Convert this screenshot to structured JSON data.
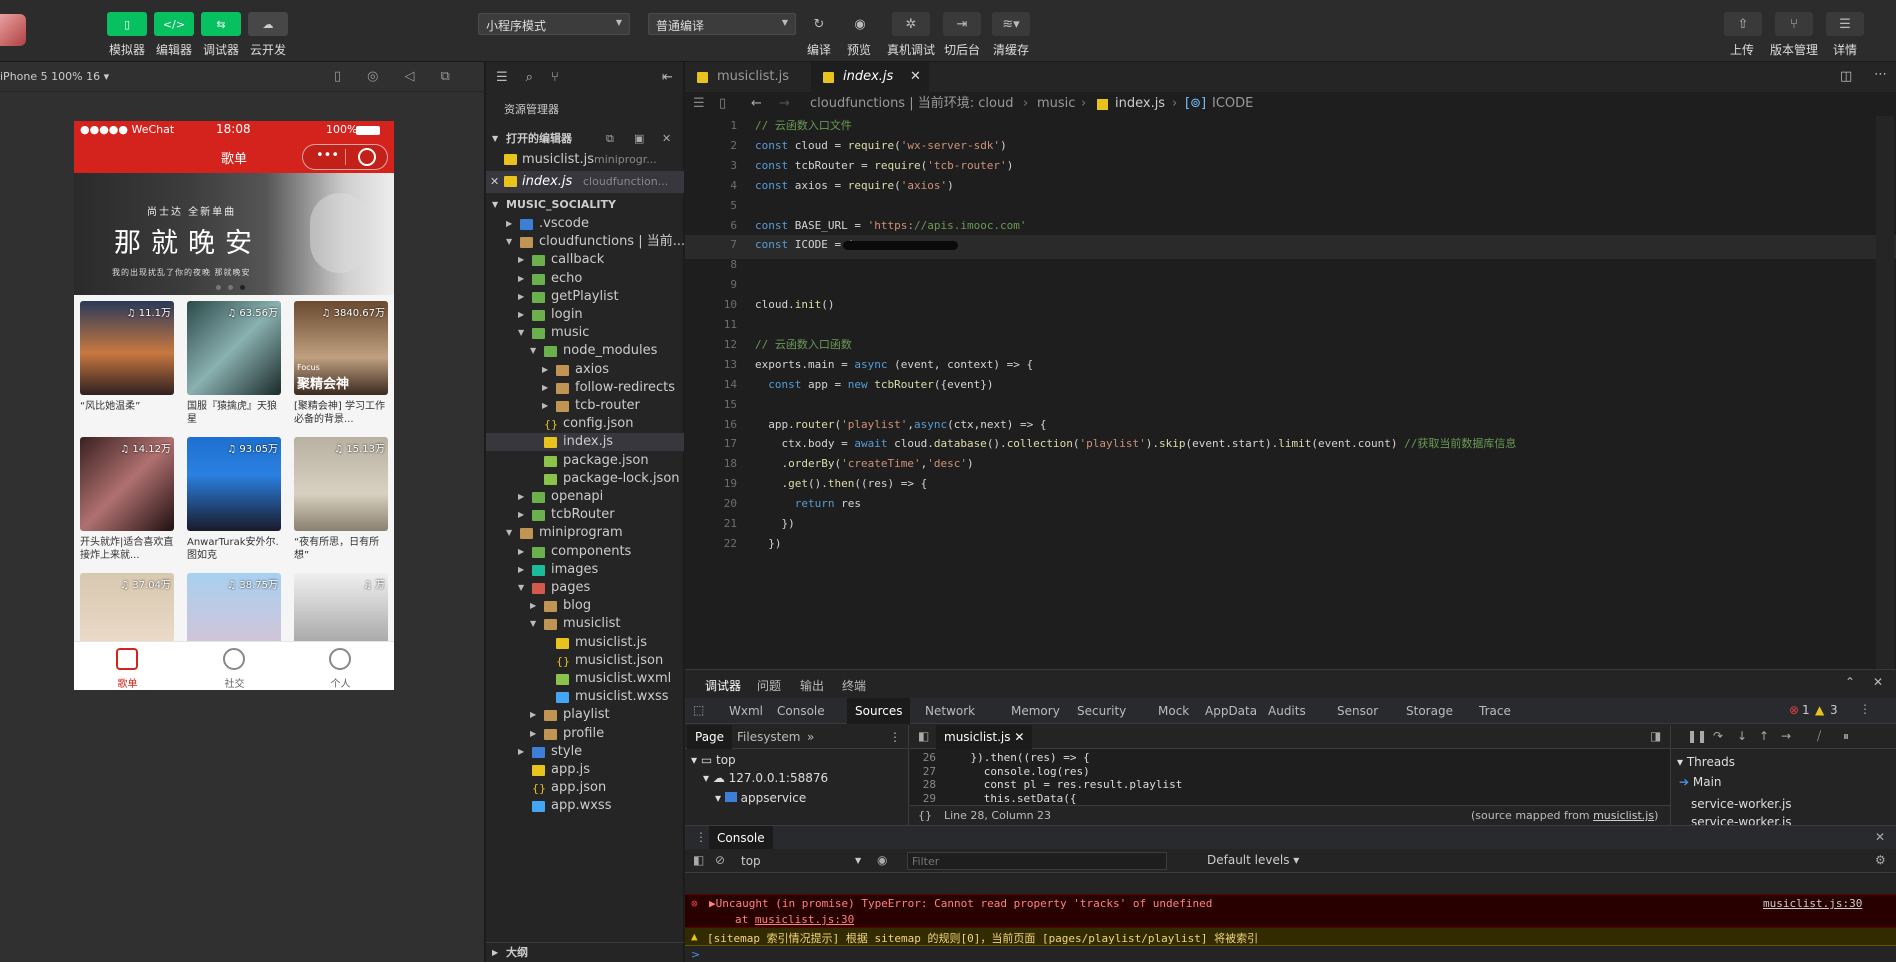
{
  "toolbar": {
    "left_buttons": [
      {
        "label": "模拟器",
        "icon": "phone-icon"
      },
      {
        "label": "编辑器",
        "icon": "code-icon"
      },
      {
        "label": "调试器",
        "icon": "debug-icon"
      },
      {
        "label": "云开发",
        "icon": "cloud-icon"
      }
    ],
    "mode_select": "小程序模式",
    "compile_select": "普通编译",
    "mid_buttons": [
      {
        "label": "编译",
        "icon": "refresh-icon"
      },
      {
        "label": "预览",
        "icon": "eye-icon"
      },
      {
        "label": "真机调试",
        "icon": "bug-icon"
      },
      {
        "label": "切后台",
        "icon": "switch-icon"
      },
      {
        "label": "清缓存",
        "icon": "layers-icon"
      }
    ],
    "right_buttons": [
      {
        "label": "上传",
        "icon": "upload-icon"
      },
      {
        "label": "版本管理",
        "icon": "branch-icon"
      },
      {
        "label": "详情",
        "icon": "menu-icon"
      }
    ]
  },
  "simulator": {
    "device": "iPhone 5 100% 16",
    "status": {
      "carrier": "●●●●● WeChat",
      "time": "18:08",
      "battery": "100%"
    },
    "nav_title": "歌单",
    "banner": {
      "top": "尚士达 全新单曲",
      "main": "那就晚安",
      "sub": "我的出现扰乱了你的夜晚 那就晚安"
    },
    "cards": [
      {
        "count": "11.1万",
        "title": "“风比她温柔”"
      },
      {
        "count": "63.56万",
        "title": "国服『猿擒虎』天狼星"
      },
      {
        "count": "3840.67万",
        "title": "[聚精会神] 学习工作必备的背景..."
      },
      {
        "count": "14.12万",
        "title": "开头就炸|适合喜欢直接炸上来就..."
      },
      {
        "count": "93.05万",
        "title": "AnwarTurak安外尔.图如克"
      },
      {
        "count": "15.13万",
        "title": "“夜有所思，日有所想”"
      },
      {
        "count": "37.04万",
        "title": ""
      },
      {
        "count": "38.75万",
        "title": ""
      },
      {
        "count": "万",
        "title": ""
      }
    ],
    "cover_focus_text": "聚精会神",
    "cover_focus_small": "Focus",
    "tabs": [
      "歌单",
      "社交",
      "个人"
    ]
  },
  "explorer": {
    "title": "资源管理器",
    "open_editors_label": "打开的编辑器",
    "open_files": [
      {
        "name": "musiclist.js",
        "path": "miniprogr..."
      },
      {
        "name": "index.js",
        "path": "cloudfunction..."
      }
    ],
    "project": "MUSIC_SOCIALITY",
    "tree": [
      {
        "name": ".vscode",
        "depth": 1,
        "type": "folder-blue",
        "open": false
      },
      {
        "name": "cloudfunctions | 当前...",
        "depth": 1,
        "type": "folder",
        "open": true
      },
      {
        "name": "callback",
        "depth": 2,
        "type": "folder-green",
        "open": false
      },
      {
        "name": "echo",
        "depth": 2,
        "type": "folder-green",
        "open": false
      },
      {
        "name": "getPlaylist",
        "depth": 2,
        "type": "folder-green",
        "open": false
      },
      {
        "name": "login",
        "depth": 2,
        "type": "folder-green",
        "open": false
      },
      {
        "name": "music",
        "depth": 2,
        "type": "folder-green",
        "open": true
      },
      {
        "name": "node_modules",
        "depth": 3,
        "type": "folder-green",
        "open": true
      },
      {
        "name": "axios",
        "depth": 4,
        "type": "folder",
        "open": false
      },
      {
        "name": "follow-redirects",
        "depth": 4,
        "type": "folder",
        "open": false
      },
      {
        "name": "tcb-router",
        "depth": 4,
        "type": "folder",
        "open": false
      },
      {
        "name": "config.json",
        "depth": 3,
        "type": "json"
      },
      {
        "name": "index.js",
        "depth": 3,
        "type": "js",
        "selected": true
      },
      {
        "name": "package.json",
        "depth": 3,
        "type": "pkg"
      },
      {
        "name": "package-lock.json",
        "depth": 3,
        "type": "pkg"
      },
      {
        "name": "openapi",
        "depth": 2,
        "type": "folder-green",
        "open": false
      },
      {
        "name": "tcbRouter",
        "depth": 2,
        "type": "folder-green",
        "open": false
      },
      {
        "name": "miniprogram",
        "depth": 1,
        "type": "folder",
        "open": true
      },
      {
        "name": "components",
        "depth": 2,
        "type": "folder-green",
        "open": false
      },
      {
        "name": "images",
        "depth": 2,
        "type": "folder-teal",
        "open": false
      },
      {
        "name": "pages",
        "depth": 2,
        "type": "folder-red",
        "open": true
      },
      {
        "name": "blog",
        "depth": 3,
        "type": "folder",
        "open": false
      },
      {
        "name": "musiclist",
        "depth": 3,
        "type": "folder",
        "open": true
      },
      {
        "name": "musiclist.js",
        "depth": 4,
        "type": "js"
      },
      {
        "name": "musiclist.json",
        "depth": 4,
        "type": "json"
      },
      {
        "name": "musiclist.wxml",
        "depth": 4,
        "type": "wxml"
      },
      {
        "name": "musiclist.wxss",
        "depth": 4,
        "type": "wxss"
      },
      {
        "name": "playlist",
        "depth": 3,
        "type": "folder",
        "open": false
      },
      {
        "name": "profile",
        "depth": 3,
        "type": "folder",
        "open": false
      },
      {
        "name": "style",
        "depth": 2,
        "type": "folder-blue",
        "open": false
      },
      {
        "name": "app.js",
        "depth": 2,
        "type": "js"
      },
      {
        "name": "app.json",
        "depth": 2,
        "type": "json"
      },
      {
        "name": "app.wxss",
        "depth": 2,
        "type": "wxss"
      }
    ],
    "outline": "大纲"
  },
  "editor": {
    "tabs": [
      "musiclist.js",
      "index.js"
    ],
    "breadcrumb": [
      "cloudfunctions | 当前环境: cloud",
      "music",
      "index.js",
      "ICODE"
    ],
    "lines": [
      {
        "n": "1",
        "t": "// 云函数入口文件",
        "kind": "comment"
      },
      {
        "n": "2",
        "t": "const cloud = require('wx-server-sdk')"
      },
      {
        "n": "3",
        "t": "const tcbRouter = require('tcb-router')"
      },
      {
        "n": "4",
        "t": "const axios = require('axios')"
      },
      {
        "n": "5",
        "t": ""
      },
      {
        "n": "6",
        "t": "const BASE_URL = 'https://apis.imooc.com'"
      },
      {
        "n": "7",
        "t": "const ICODE = '",
        "hl": true
      },
      {
        "n": "8",
        "t": ""
      },
      {
        "n": "9",
        "t": ""
      },
      {
        "n": "10",
        "t": "cloud.init()"
      },
      {
        "n": "11",
        "t": ""
      },
      {
        "n": "12",
        "t": "// 云函数入口函数",
        "kind": "comment"
      },
      {
        "n": "13",
        "t": "exports.main = async (event, context) => {"
      },
      {
        "n": "14",
        "t": "  const app = new tcbRouter({event})"
      },
      {
        "n": "15",
        "t": ""
      },
      {
        "n": "16",
        "t": "  app.router('playlist',async(ctx,next) => {"
      },
      {
        "n": "17",
        "t": "    ctx.body = await cloud.database().collection('playlist').skip(event.start).limit(event.count) //获取当前数据库信息"
      },
      {
        "n": "18",
        "t": "    .orderBy('createTime','desc')"
      },
      {
        "n": "19",
        "t": "    .get().then((res) => {"
      },
      {
        "n": "20",
        "t": "      return res"
      },
      {
        "n": "21",
        "t": "    })"
      },
      {
        "n": "22",
        "t": "  })"
      }
    ]
  },
  "debugger": {
    "tabs": [
      "调试器",
      "问题",
      "输出",
      "终端"
    ],
    "devtools_tabs": [
      "Wxml",
      "Console",
      "Sources",
      "Network",
      "Memory",
      "Security",
      "Mock",
      "AppData",
      "Audits",
      "Sensor",
      "Storage",
      "Trace"
    ],
    "error_count": "1",
    "warning_count": "3",
    "sources_nav_tabs": [
      "Page",
      "Filesystem"
    ],
    "source_tree": [
      "top",
      "127.0.0.1:58876",
      "appservice"
    ],
    "open_file": "musiclist.js",
    "source_lines": [
      {
        "n": "26",
        "t": "    }).then((res) => {"
      },
      {
        "n": "27",
        "t": "      console.log(res)"
      },
      {
        "n": "28",
        "t": "      const pl = res.result.playlist"
      },
      {
        "n": "29",
        "t": "      this.setData({"
      }
    ],
    "cursor_pos": "Line 28, Column 23",
    "source_mapped": "(source mapped from ",
    "source_mapped_file": "musiclist.js",
    "source_mapped_end": ")",
    "threads_label": "Threads",
    "threads": [
      "Main",
      "service-worker.js",
      "service-worker.js"
    ],
    "console_label": "Console",
    "context": "top",
    "filter_placeholder": "Filter",
    "levels": "Default levels",
    "error_msg": "▶Uncaught (in promise) TypeError: Cannot read property 'tracks' of undefined",
    "error_at": "at ",
    "error_at_link": "musiclist.js:30",
    "error_src": "musiclist.js:30",
    "warn_msg": "[sitemap 索引情况提示] 根据 sitemap 的规则[0]，当前页面 [pages/playlist/playlist] 将被索引",
    "prompt": ">"
  },
  "colors": {
    "accent_green": "#07c160",
    "wechat_red": "#d4231c",
    "comment": "#6a9955",
    "keyword": "#569cd6",
    "string": "#ce9178",
    "func": "#dcdcaa"
  }
}
